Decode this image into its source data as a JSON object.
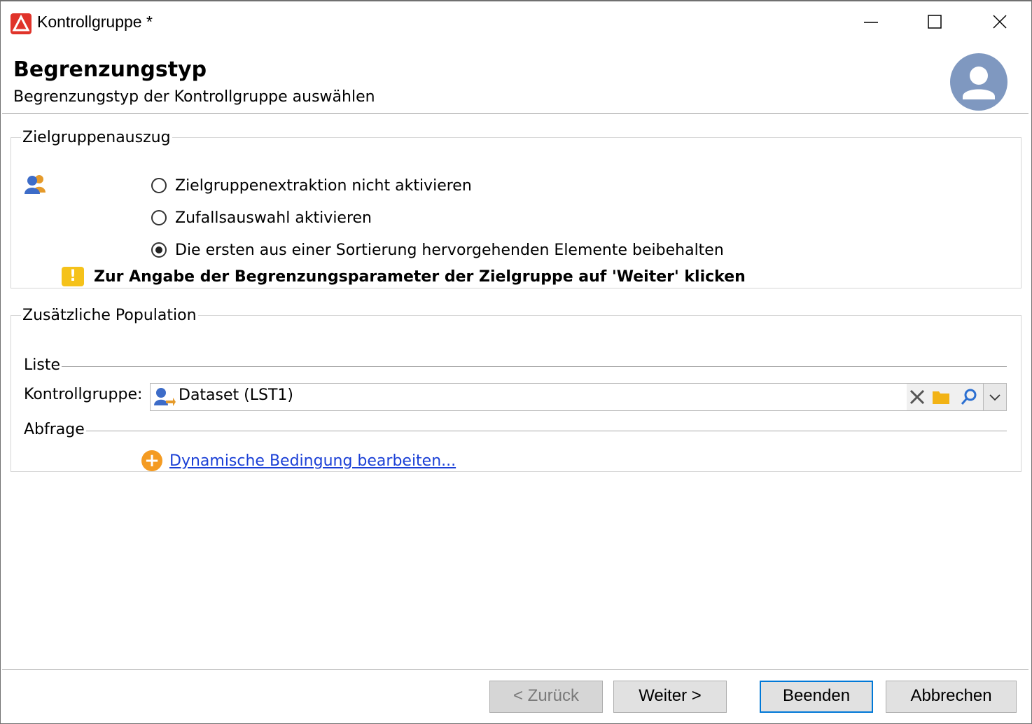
{
  "window": {
    "title": "Kontrollgruppe *"
  },
  "header": {
    "title": "Begrenzungstyp",
    "subtitle": "Begrenzungstyp der Kontrollgruppe auswählen"
  },
  "extract_group": {
    "legend": "Zielgruppenauszug",
    "options": [
      {
        "label": "Zielgruppenextraktion nicht aktivieren",
        "checked": false
      },
      {
        "label": "Zufallsauswahl aktivieren",
        "checked": false
      },
      {
        "label": "Die ersten aus einer Sortierung hervorgehenden Elemente beibehalten",
        "checked": true
      }
    ],
    "warning": "Zur Angabe der Begrenzungsparameter der Zielgruppe auf 'Weiter' klicken"
  },
  "population_group": {
    "legend": "Zusätzliche Population",
    "list_label": "Liste",
    "control_group_label": "Kontrollgruppe:",
    "control_group_value": "Dataset (LST1)",
    "query_label": "Abfrage",
    "dynamic_link": "Dynamische Bedingung bearbeiten..."
  },
  "footer": {
    "back": "< Zurück",
    "next": "Weiter >",
    "finish": "Beenden",
    "cancel": "Abbrechen"
  },
  "colors": {
    "app_icon": "#e0332a",
    "link": "#1a3fd6",
    "warning": "#f5c21a",
    "plus": "#f49b22",
    "avatar": "#7f98c0",
    "primary_border": "#0078d7"
  },
  "icons": {
    "app": "adobe-campaign-icon",
    "avatar": "user-avatar-icon",
    "population": "users-icon",
    "warning": "warning-icon",
    "list": "list-recipients-icon",
    "clear": "clear-icon",
    "folder": "folder-icon",
    "search": "search-icon",
    "dropdown": "chevron-down-icon",
    "add": "plus-circle-icon"
  }
}
